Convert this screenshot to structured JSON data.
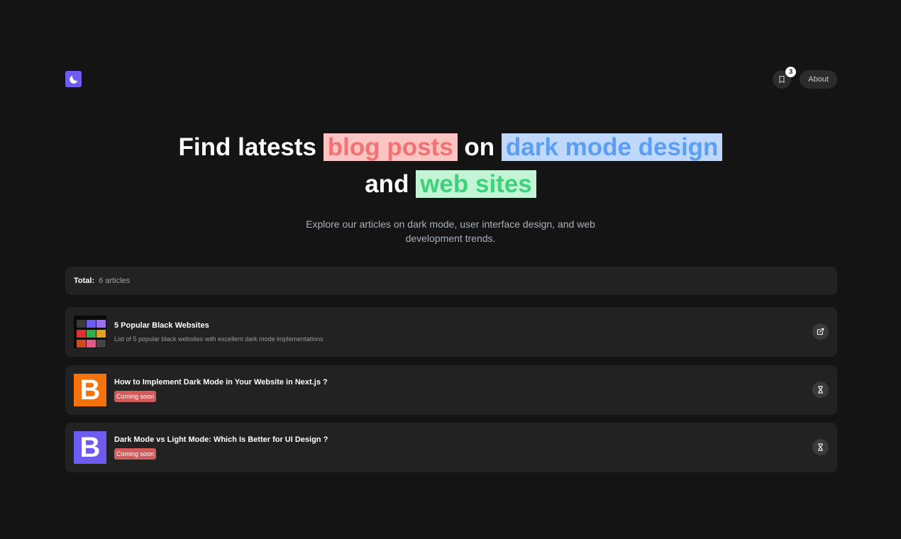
{
  "header": {
    "logo_icon": "moon-icon",
    "bookmark_icon": "bookmark-icon",
    "bookmark_count": "3",
    "about_label": "About"
  },
  "hero": {
    "title_part1": "Find latests",
    "highlight1": "blog posts",
    "title_part2": "on",
    "highlight2": "dark mode design",
    "title_part3": "and",
    "highlight3": "web sites",
    "subtitle": "Explore our articles on dark mode, user interface design, and web development trends."
  },
  "summary": {
    "label": "Total:",
    "count": "6 articles"
  },
  "articles": [
    {
      "title": "5 Popular Black Websites",
      "description": "List of 5 popular black websites with excellent dark mode implementations",
      "action_icon": "external-link-icon"
    },
    {
      "title": "How to Implement Dark Mode in Your Website in Next.js ?",
      "status": "Coming soon",
      "thumb_letter": "B",
      "thumb_color": "#f5730a",
      "action_icon": "hourglass-icon"
    },
    {
      "title": "Dark Mode vs Light Mode: Which Is Better for UI Design ?",
      "status": "Coming soon",
      "thumb_letter": "B",
      "thumb_color": "#6e5cf0",
      "action_icon": "hourglass-icon"
    }
  ],
  "colors": {
    "background": "#141414",
    "card": "#222222",
    "accent_purple": "#6e5cf0",
    "coming_soon": "#d05c5c"
  }
}
